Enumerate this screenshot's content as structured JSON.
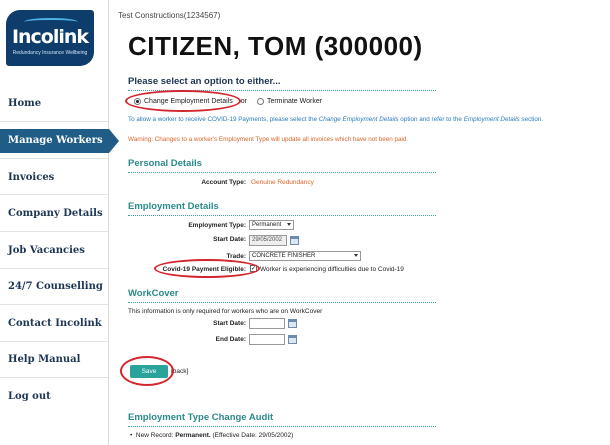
{
  "logo": {
    "brand": "Incolink",
    "tagline": "Redundancy Insurance Wellbeing"
  },
  "nav": {
    "items": [
      {
        "label": "Home"
      },
      {
        "label": "Manage Workers",
        "active": true
      },
      {
        "label": "Invoices"
      },
      {
        "label": "Company Details"
      },
      {
        "label": "Job Vacancies"
      },
      {
        "label": "24/7 Counselling"
      },
      {
        "label": "Contact Incolink"
      },
      {
        "label": "Help Manual"
      },
      {
        "label": "Log out"
      }
    ]
  },
  "header": {
    "company": "Test Constructions(1234567)",
    "worker": "CITIZEN, TOM (300000)"
  },
  "select_option": {
    "heading": "Please select an option to either...",
    "option_change": "Change Employment Details",
    "or_text": "or",
    "option_terminate": "Terminate Worker",
    "selected": "Change Employment Details"
  },
  "info": {
    "part1": "To allow a worker to receive COVID-19 Payments, please select the ",
    "link1": "Change Employment Details",
    "part2": " option and refer to the ",
    "link2": "Employment Details",
    "part3": " section."
  },
  "warning": "Warning: Changes to a worker's Employment Type will update all invoices which have not been paid.",
  "personal": {
    "heading": "Personal Details",
    "account_type_label": "Account Type:",
    "account_type_value": "Genuine Redundancy"
  },
  "employment": {
    "heading": "Employment Details",
    "employment_type_label": "Employment Type:",
    "employment_type_value": "Permanent",
    "start_date_label": "Start Date:",
    "start_date_value": "29/05/2002",
    "trade_label": "Trade:",
    "trade_value": "CONCRETE FINISHER",
    "covid_label": "Covid-19 Payment Eligible:",
    "covid_checked": true,
    "covid_text": "Worker is experiencing difficulties due to Covid-19"
  },
  "workcover": {
    "heading": "WorkCover",
    "note": "This information is only required for workers who are on WorkCover",
    "start_date_label": "Start Date:",
    "start_date_value": "",
    "end_date_label": "End Date:",
    "end_date_value": ""
  },
  "actions": {
    "save_label": "Save",
    "back_label": "[back]"
  },
  "audit": {
    "heading": "Employment Type Change Audit",
    "item_prefix": "New Record: ",
    "item_bold": "Permanent.",
    "item_suffix": " (Effective Date: 29/05/2002)"
  },
  "colors": {
    "sidebar_active": "#1f5c86",
    "section_heading": "#2b8a8a",
    "link_blue": "#2b7bbf",
    "warning_orange": "#d9652b",
    "save_button": "#2aa39a",
    "annotation_red": "#d3262e"
  }
}
